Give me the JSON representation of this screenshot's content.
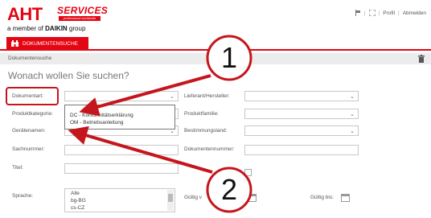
{
  "logo": {
    "brand": "AHT",
    "services": "SERVICES",
    "services_sub": "professional worldwide",
    "member_prefix": "a member of ",
    "member_brand": "DAIKIN",
    "member_suffix": " group"
  },
  "topnav": {
    "sep": "|",
    "profile": "Profil",
    "logout": "Abmelden"
  },
  "tab": {
    "label": "DOKUMENTENSUCHE"
  },
  "pagebar": {
    "title": "Dokumentensuche"
  },
  "heading": "Wonach wollen Sie suchen?",
  "form": {
    "dokumentart": "Dokumentart:",
    "produktkategorie": "Produktkategorie:",
    "geraetenamen": "Gerätenamen:",
    "sachnummer": "Sachnummer:",
    "titel": "Titel:",
    "sprache": "Sprache:",
    "lieferant": "Lieferant/Hersteller:",
    "produktfamilie": "Produktfamilie:",
    "bestimmungsland": "Bestimmungsland:",
    "dokumentennummer": "Dokumentennummer:",
    "gueltig_von": "Gültig v",
    "gueltig_bis": "Gültig bis:"
  },
  "dropdown_options": [
    "DC - Konformitätserklärung",
    "OM - Betriebsanleitung"
  ],
  "languages": [
    "Alle",
    "bg-BG",
    "cs-CZ"
  ],
  "callouts": {
    "one": "1",
    "two": "2"
  },
  "colors": {
    "brand_red": "#e30613",
    "highlight": "#c4161c"
  }
}
